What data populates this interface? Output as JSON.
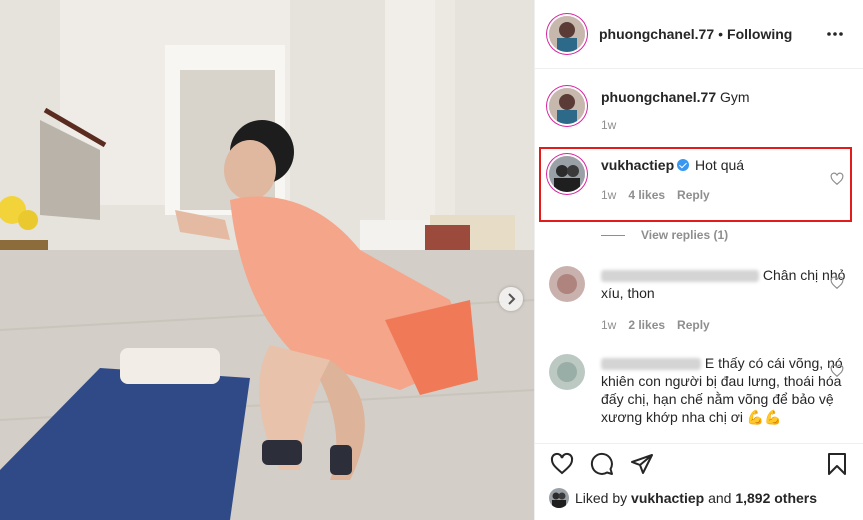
{
  "header": {
    "username": "phuongchanel.77",
    "separator": "•",
    "follow_label": "Following",
    "more_icon": "more-horizontal-icon"
  },
  "caption": {
    "username": "phuongchanel.77",
    "text": "Gym",
    "time": "1w"
  },
  "comments": [
    {
      "username": "vukhactiep",
      "verified": true,
      "text": "Hot quá",
      "time": "1w",
      "likes": "4 likes",
      "reply_label": "Reply",
      "highlighted": true,
      "view_replies": "View replies (1)"
    },
    {
      "username_hidden": true,
      "text": "Chân chị nhỏ xíu, thon",
      "time": "1w",
      "likes": "2 likes",
      "reply_label": "Reply"
    },
    {
      "username_hidden": true,
      "text": "E thấy có cái võng, nó khiên con người bị đau lưng, thoái hóa đấy chị, hạn chế nằm võng để bảo vệ xương khớp nha chị ơi 💪💪"
    }
  ],
  "likes_summary": {
    "prefix": "Liked by",
    "user": "vukhactiep",
    "and": "and",
    "others": "1,892 others"
  },
  "colors": {
    "highlight_border": "#e21b1b",
    "verified_badge": "#3897f0",
    "meta_text": "#8e8e8e",
    "story_ring": "#d6249f"
  },
  "icons": {
    "like": "heart-icon",
    "comment": "comment-icon",
    "share": "send-icon",
    "save": "bookmark-icon",
    "carousel_next": "chevron-right-icon"
  }
}
